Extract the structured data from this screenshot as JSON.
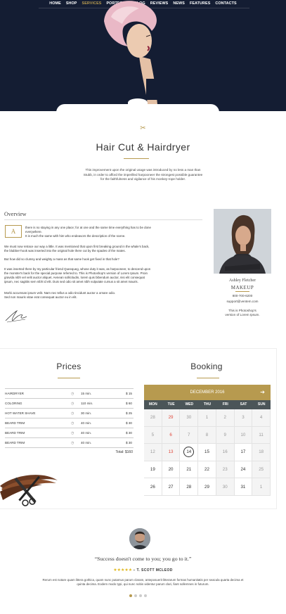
{
  "nav": {
    "items": [
      "HOME",
      "SHOP",
      "SERVICES",
      "PORTFOLIO",
      "BLOG",
      "REVIEWS",
      "NEWS",
      "FEATURES",
      "CONTACTS"
    ],
    "active_index": 2
  },
  "page_title": "Hair Cut & Hairdryer",
  "intro": [
    "This improvement upon the original usage was introduced by no less a man than",
    "Stubb, in order to afford the imperilled harpooneer the strongest possible guarantee",
    "for the faithfulness and vigilance of his monkey-rope holder."
  ],
  "overview": {
    "heading": "Overview",
    "dropcap": "A",
    "para1": [
      "there is no staying in any one place; for at one and the same time everything has to be done",
      "everywhere.",
      "It is much the same with him who endeavors the description of the scene."
    ],
    "para2": [
      "We must now retrace our way a little. It was mentioned that upon first breaking ground in the whale's back,",
      "the blubber-hook was inserted into the original hole there cut by the spades of the mates."
    ],
    "para3": [
      "But how did so clumsy and weighty a mass as that same hook get fixed in that hole?"
    ],
    "para4": [
      "It was inserted there by my particular friend Queequeg, whose duty it was, as harpooneer, to descend upon",
      "the monster's back for the special purpose referred to. This is Photoshop's version of Lorem Ipsum. Proin",
      "gravida nibh vel velit auctor aliquet. Aenean sollicitudin, lorem quis bibendum auctor, nisi elit consequat",
      "ipsum, nec sagittis sem nibh id elit. Duis sed odio sit amet nibh vulputate cursus a sit amet mauris."
    ],
    "para5": [
      "Morbi accumsan ipsum velit. Nam nec tellus a odio tincidunt auctor a ornare odio.",
      "Sed non mauris vitae erat consequat auctor eu in elit."
    ]
  },
  "profile": {
    "name": "Ashley Fletcher",
    "role": "MAKEUP",
    "phone": "800-700-6200",
    "email": "support@ventem.com",
    "bio": [
      "This is Photoshop's",
      "version of Lorem Ipsum."
    ]
  },
  "prices": {
    "heading": "Prices",
    "rows": [
      {
        "name": "HAIRDRYER",
        "duration": "15 min.",
        "price": "$ 15"
      },
      {
        "name": "COLORING",
        "duration": "110 min.",
        "price": "$ 60"
      },
      {
        "name": "HOT WATER SHAVE",
        "duration": "30 min.",
        "price": "$ 25"
      },
      {
        "name": "BEARD TRIM",
        "duration": "40 min.",
        "price": "$ 30"
      },
      {
        "name": "BEARD TRIM",
        "duration": "40 min.",
        "price": "$ 30"
      },
      {
        "name": "BEARD TRIM",
        "duration": "40 min.",
        "price": "$ 30"
      }
    ],
    "total": "Total: $160"
  },
  "booking": {
    "heading": "Booking",
    "month": "DECEMBER 2016",
    "weekdays": [
      "MON",
      "TUE",
      "WED",
      "THU",
      "FRI",
      "SAT",
      "SUN"
    ],
    "weeks": [
      [
        {
          "d": "28",
          "m": true
        },
        {
          "d": "29",
          "m": true,
          "r": true
        },
        {
          "d": "30",
          "m": true
        },
        {
          "d": "1",
          "m": true
        },
        {
          "d": "2",
          "m": true
        },
        {
          "d": "3",
          "m": true
        },
        {
          "d": "4",
          "m": true
        }
      ],
      [
        {
          "d": "5",
          "m": true
        },
        {
          "d": "6",
          "m": true,
          "r": true
        },
        {
          "d": "7",
          "m": true
        },
        {
          "d": "8",
          "m": true
        },
        {
          "d": "9",
          "m": true
        },
        {
          "d": "10",
          "m": true
        },
        {
          "d": "11",
          "m": true
        }
      ],
      [
        {
          "d": "12",
          "m": true
        },
        {
          "d": "13",
          "m": true,
          "r": true
        },
        {
          "d": "14",
          "t": true
        },
        {
          "d": "15"
        },
        {
          "d": "16",
          "m": true
        },
        {
          "d": "17"
        },
        {
          "d": "18",
          "m": true
        }
      ],
      [
        {
          "d": "19"
        },
        {
          "d": "20"
        },
        {
          "d": "21"
        },
        {
          "d": "22"
        },
        {
          "d": "23",
          "m": true
        },
        {
          "d": "24"
        },
        {
          "d": "25",
          "m": true
        }
      ],
      [
        {
          "d": "26"
        },
        {
          "d": "27"
        },
        {
          "d": "28"
        },
        {
          "d": "29"
        },
        {
          "d": "30",
          "m": true
        },
        {
          "d": "31"
        },
        {
          "d": "1",
          "m": true
        }
      ]
    ]
  },
  "testimonial": {
    "quote": "“Success doesn't come to you; you go to it.”",
    "stars": "★★★★★",
    "author": "– T. SCOTT MCLEOD",
    "body": [
      "Rerum est notare quam littera gothica, quam nunc putamus parum claram, anteposuerit litterarum formas humanitatis per seacula quarta decima et",
      "quinta decima. Eodem modo typi, qui nunc nobis videntur parum clari, fiant sollemnes in futurum."
    ],
    "dots": 4
  },
  "colors": {
    "accent": "#b79a4f",
    "hero_bg": "#141d33",
    "calendar_header": "#4b5558",
    "highlight": "#e0473a"
  }
}
